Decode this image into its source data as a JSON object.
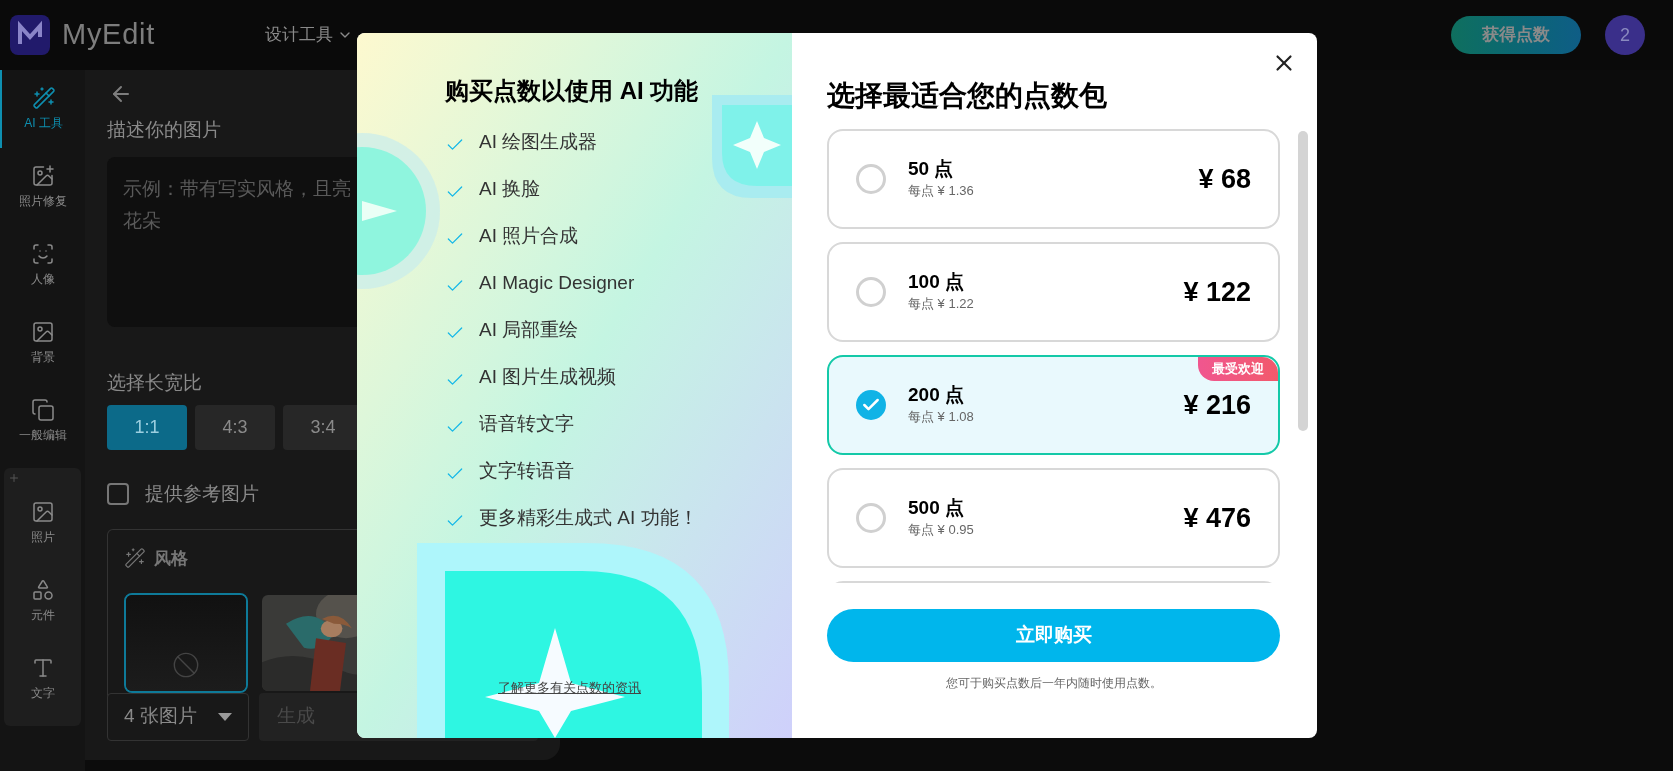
{
  "header": {
    "logo_text": "MyEdit",
    "nav": [
      {
        "label": "设计工具",
        "selected": false
      }
    ],
    "get_points_button": "获得点数",
    "avatar": "2"
  },
  "sidebar": {
    "tools": [
      {
        "label": "AI 工具",
        "selected": true
      },
      {
        "label": "照片修复",
        "selected": false
      },
      {
        "label": "人像",
        "selected": false
      },
      {
        "label": "背景",
        "selected": false
      },
      {
        "label": "一般编辑",
        "selected": false
      }
    ],
    "assets": [
      {
        "label": "照片",
        "selected": false
      },
      {
        "label": "元件",
        "selected": false
      },
      {
        "label": "文字",
        "selected": false
      }
    ]
  },
  "panel": {
    "prompt_label": "描述你的图片",
    "prompt_placeholder": "示例：带有写实风格，且亮花朵",
    "ratio_label": "选择长宽比",
    "ratios": [
      {
        "label": "1:1",
        "selected": true
      },
      {
        "label": "4:3",
        "selected": false
      },
      {
        "label": "3:4",
        "selected": false
      }
    ],
    "reference": {
      "label": "提供参考图片",
      "checked": false
    },
    "style": {
      "title": "风格",
      "options": [
        {
          "kind": "none",
          "selected": true
        },
        {
          "kind": "picture",
          "selected": false
        }
      ]
    },
    "count_select": "4 张图片",
    "generate": {
      "label": "生成",
      "disabled": true
    }
  },
  "modal": {
    "features_title": "购买点数以使用 AI 功能",
    "features": [
      "AI 绘图生成器",
      "AI 换脸",
      "AI 照片合成",
      "AI Magic Designer",
      "AI 局部重绘",
      "AI 图片生成视频",
      "语音转文字",
      "文字转语音",
      "更多精彩生成式 AI 功能！"
    ],
    "info_link": "了解更多有关点数的资讯",
    "packages_title": "选择最适合您的点数包",
    "packages": [
      {
        "points": "50 点",
        "per_point": "每点 ¥ 1.36",
        "price": "¥ 68",
        "selected": false
      },
      {
        "points": "100 点",
        "per_point": "每点 ¥ 1.22",
        "price": "¥ 122",
        "selected": false
      },
      {
        "points": "200 点",
        "per_point": "每点 ¥ 1.08",
        "price": "¥ 216",
        "selected": true,
        "badge": "最受欢迎"
      },
      {
        "points": "500 点",
        "per_point": "每点 ¥ 0.95",
        "price": "¥ 476",
        "selected": false
      }
    ],
    "buy_button": "立即购买",
    "note": "您可于购买点数后一年内随时使用点数。"
  }
}
